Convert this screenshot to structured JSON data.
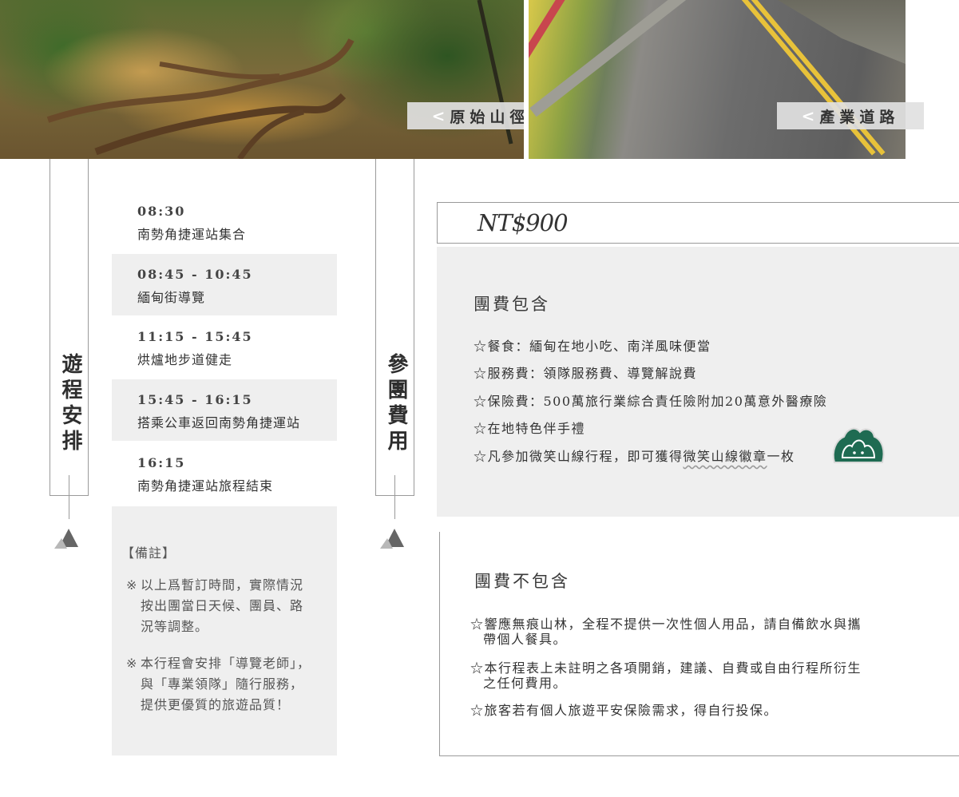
{
  "photos": {
    "trail_label": "原始山徑",
    "road_label": "產業道路",
    "chevron": "<"
  },
  "schedule": {
    "heading": "遊程安排",
    "items": [
      {
        "time": "08:30",
        "desc": "南勢角捷運站集合"
      },
      {
        "time": "08:45 - 10:45",
        "desc": "緬甸街導覽"
      },
      {
        "time": "11:15 - 15:45",
        "desc": "烘爐地步道健走"
      },
      {
        "time": "15:45 - 16:15",
        "desc": "搭乘公車返回南勢角捷運站"
      },
      {
        "time": "16:15",
        "desc": "南勢角捷運站旅程結束"
      }
    ]
  },
  "notes": {
    "title": "【備註】",
    "mark": "※",
    "note1_lines": [
      "以上爲暫訂時間，實際情況",
      "按出團當日天候、團員、路",
      "況等調整。"
    ],
    "note2_lines": [
      "本行程會安排「導覽老師」，",
      "與「專業領隊」隨行服務，",
      "提供更優質的旅遊品質！"
    ]
  },
  "fees": {
    "heading": "參團費用",
    "price": "NT$900",
    "included_title": "團費包含",
    "included": [
      "☆餐食：緬甸在地小吃、南洋風味便當",
      "☆服務費：領隊服務費、導覽解說費",
      "☆保險費：500萬旅行業綜合責任險附加20萬意外醫療險",
      "☆在地特色伴手禮"
    ],
    "badge_line_prefix": "☆凡參加微笑山線行程，即可獲得",
    "badge_line_highlight": "微笑山線徽章",
    "badge_line_suffix": "一枚",
    "excluded_title": "團費不包含",
    "excluded": [
      [
        "☆響應無痕山林，全程不提供一次性個人用品，請自備飲水與攜",
        "帶個人餐具。"
      ],
      [
        "☆本行程表上未註明之各項開銷，建議、自費或自由行程所衍生",
        "之任何費用。"
      ],
      [
        "☆旅客若有個人旅遊平安保險需求，得自行投保。"
      ]
    ]
  },
  "colors": {
    "shade": "#efefef",
    "line": "#9a9a9a",
    "badge": "#1f6b52",
    "triangle_dark": "#666666",
    "triangle_light": "#b8b8b8"
  },
  "icons": [
    "mountain-triangle-icon",
    "smile-mountain-badge-icon",
    "chevron-left-icon"
  ]
}
